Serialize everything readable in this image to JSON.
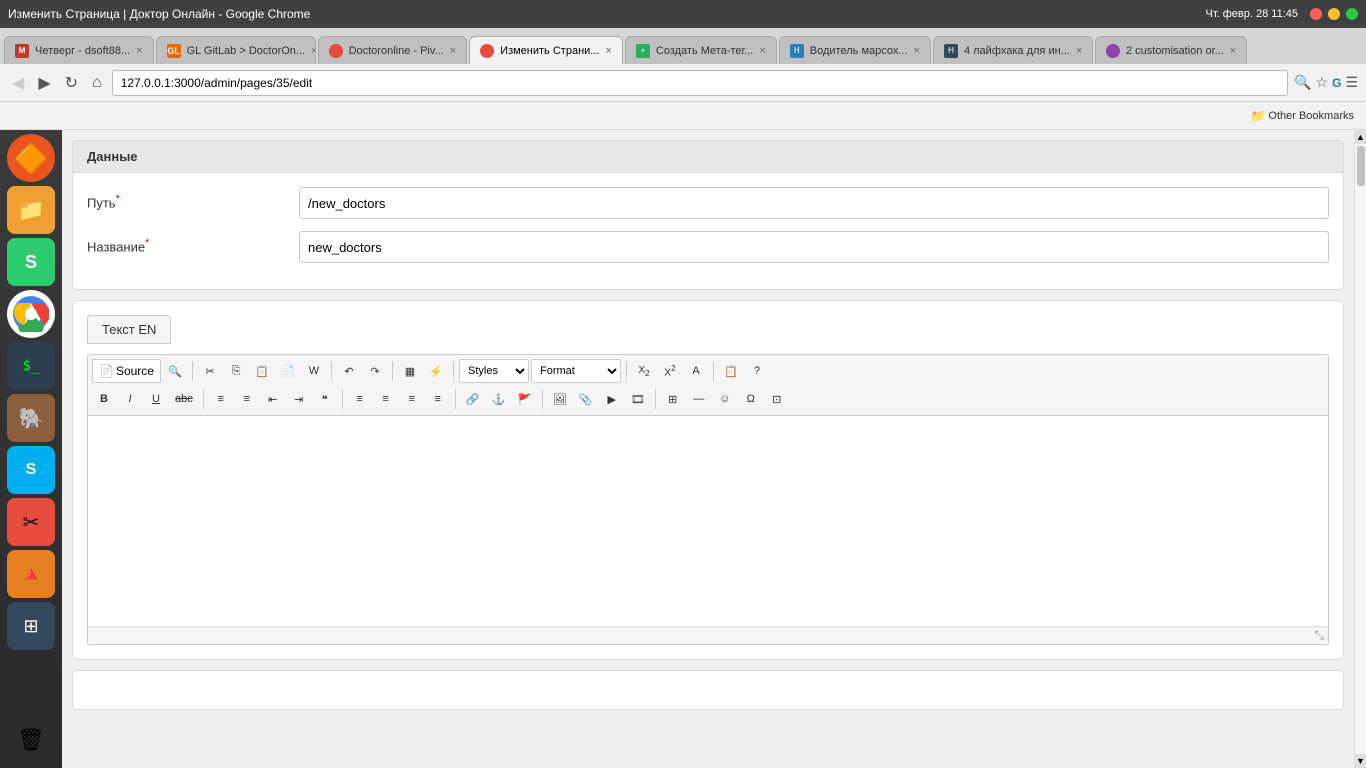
{
  "window": {
    "title": "Изменить Страница | Доктор Онлайн - Google Chrome",
    "os_time": "Чт. февр. 28  11:45"
  },
  "tabs": [
    {
      "id": "gmail",
      "label": "Четверг - dsoft88...",
      "favicon_type": "gmail",
      "active": false
    },
    {
      "id": "gitlab",
      "label": "GL GitLab > DoctorOn...",
      "favicon_type": "gl",
      "active": false
    },
    {
      "id": "doctoronline",
      "label": "Doctoronline - Piv...",
      "favicon_type": "active-red",
      "active": false
    },
    {
      "id": "izmenit",
      "label": "Изменить Страни...",
      "favicon_type": "active-red",
      "active": true
    },
    {
      "id": "sozdanie",
      "label": "Создать Мета-тег...",
      "favicon_type": "create",
      "active": false
    },
    {
      "id": "voditel",
      "label": "Водитель марсох...",
      "favicon_type": "h",
      "active": false
    },
    {
      "id": "laifhak",
      "label": "4 лайфхака для ин...",
      "favicon_type": "h2",
      "active": false
    },
    {
      "id": "customisation",
      "label": "2 customisation or...",
      "favicon_type": "cust",
      "active": false
    }
  ],
  "address_bar": {
    "url": "127.0.0.1:3000/admin/pages/35/edit"
  },
  "bookmarks": {
    "label": "Other Bookmarks"
  },
  "page": {
    "section_data_label": "Данные",
    "path_label": "Путь",
    "path_required": "*",
    "path_value": "/new_doctors",
    "name_label": "Название",
    "name_required": "*",
    "name_value": "new_doctors",
    "text_tab_label": "Текст EN",
    "editor": {
      "source_btn": "Source",
      "styles_placeholder": "Styles",
      "format_placeholder": "Format",
      "toolbar_row1": {
        "source": "Source",
        "find": "🔍",
        "cut": "✂",
        "copy": "⎘",
        "paste": "📋",
        "paste_text": "📄",
        "paste_word": "📝",
        "undo": "↶",
        "redo": "↷",
        "template": "▦",
        "ajax": "⚡"
      },
      "toolbar_row2": {
        "bold": "B",
        "italic": "I",
        "underline": "U",
        "strike": "abc",
        "ol": "ol",
        "ul": "ul",
        "outdent": "⇤",
        "indent": "⇥",
        "blockquote": "❝",
        "align_left": "≡",
        "align_center": "≡",
        "align_right": "≡",
        "justify": "≡"
      }
    }
  },
  "dock_items": [
    {
      "id": "ubuntu",
      "icon": "🔶",
      "type": "ubuntu"
    },
    {
      "id": "files",
      "icon": "📁",
      "type": "files"
    },
    {
      "id": "text-editor",
      "icon": "S",
      "type": "text"
    },
    {
      "id": "chrome",
      "icon": "◉",
      "type": "chrome",
      "active": true
    },
    {
      "id": "terminal",
      "icon": "⬛",
      "type": "terminal"
    },
    {
      "id": "db",
      "icon": "🐘",
      "type": "db"
    },
    {
      "id": "skype",
      "icon": "S",
      "type": "skype"
    },
    {
      "id": "tool",
      "icon": "✂",
      "type": "tool"
    },
    {
      "id": "deploy",
      "icon": "🔼",
      "type": "deploy"
    },
    {
      "id": "grid",
      "icon": "⊞",
      "type": "grid"
    },
    {
      "id": "trash",
      "icon": "🗑",
      "type": "trash"
    }
  ]
}
